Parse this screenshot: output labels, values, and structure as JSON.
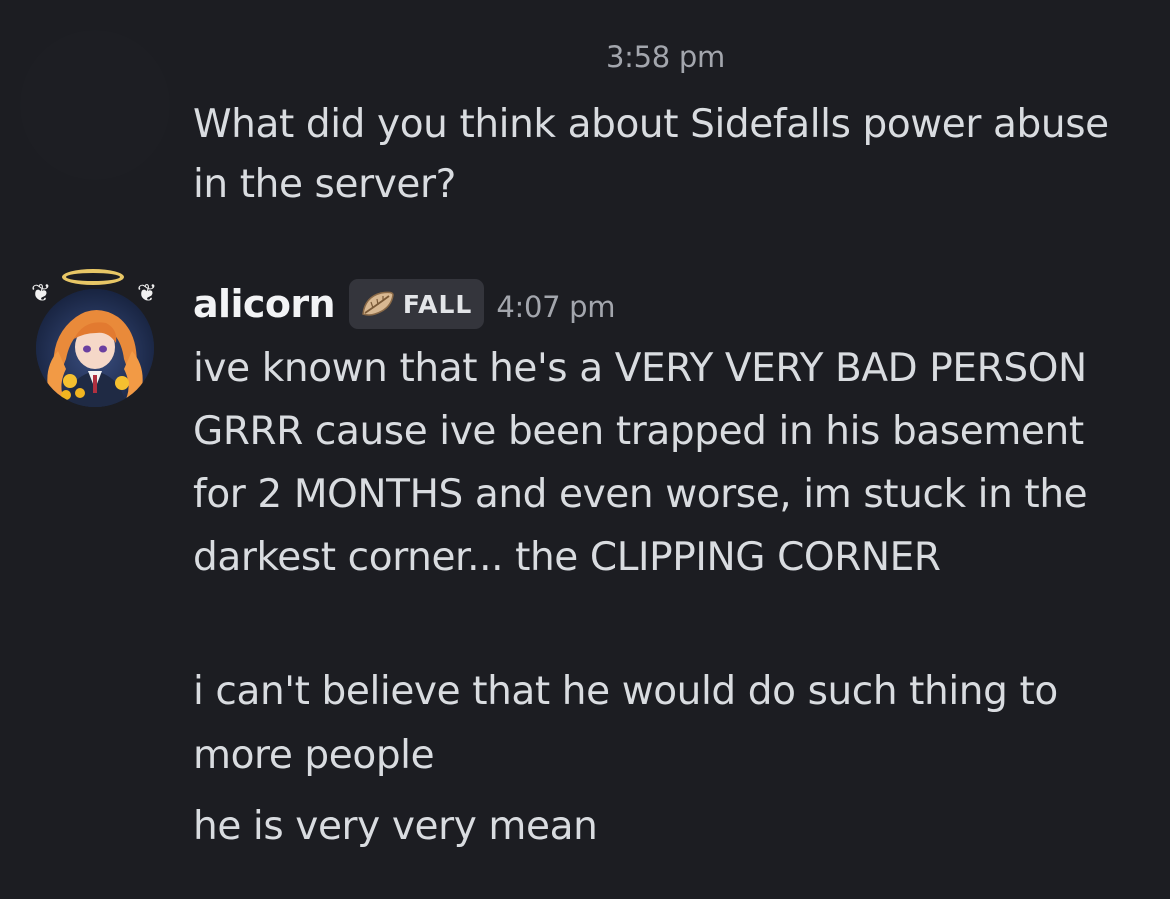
{
  "colors": {
    "background": "#1c1d22",
    "text": "#d9dce0",
    "username": "#f2f3f5",
    "timestamp": "#a3a6ad",
    "role_tag_bg": "#34353c",
    "halo": "#e8c766"
  },
  "previous_message": {
    "timestamp": "3:58 pm",
    "text": "What did you think about Sidefalls power abuse in the server?"
  },
  "message_group": {
    "author": "alicorn",
    "role_tag": {
      "icon": "leaf-icon",
      "label": "FALL"
    },
    "timestamp": "4:07 pm",
    "messages": [
      "ive known that he's a VERY VERY BAD PERSON GRRR cause ive been trapped in his basement for 2 MONTHS and even worse, im stuck in the darkest corner... the CLIPPING CORNER",
      "i can't believe that he would do such thing to more people",
      "he is very very mean"
    ]
  }
}
